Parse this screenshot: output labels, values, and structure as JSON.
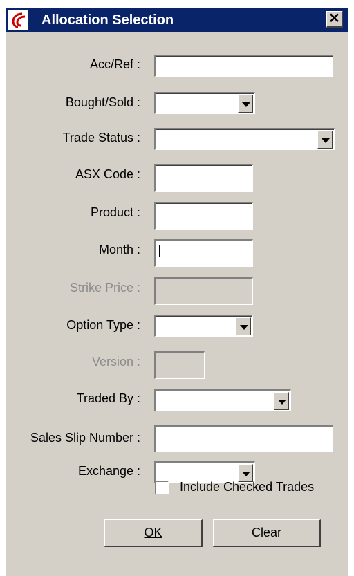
{
  "window": {
    "title": "Allocation Selection",
    "close_label": "✕",
    "colors": {
      "titlebar": "#0a246a",
      "face": "#d4d0c8",
      "disabled_text": "#8c8c8c"
    }
  },
  "fields": {
    "acc_ref": {
      "label": "Acc/Ref :",
      "value": ""
    },
    "bought_sold": {
      "label": "Bought/Sold :",
      "value": ""
    },
    "trade_status": {
      "label": "Trade Status :",
      "value": ""
    },
    "asx_code": {
      "label": "ASX Code :",
      "value": ""
    },
    "product": {
      "label": "Product :",
      "value": ""
    },
    "month": {
      "label": "Month :",
      "value": ""
    },
    "strike_price": {
      "label": "Strike Price :",
      "value": ""
    },
    "option_type": {
      "label": "Option Type :",
      "value": ""
    },
    "version": {
      "label": "Version :",
      "value": ""
    },
    "traded_by": {
      "label": "Traded By :",
      "value": ""
    },
    "sales_slip_number": {
      "label": "Sales Slip Number :",
      "value": ""
    },
    "exchange": {
      "label": "Exchange :",
      "value": ""
    }
  },
  "include_checked_trades": {
    "label": "Include Checked Trades",
    "checked": false
  },
  "buttons": {
    "ok": "OK",
    "clear": "Clear"
  },
  "icons": {
    "app": "app-logo-icon",
    "close": "close-icon",
    "dropdown": "dropdown-arrow-icon"
  }
}
